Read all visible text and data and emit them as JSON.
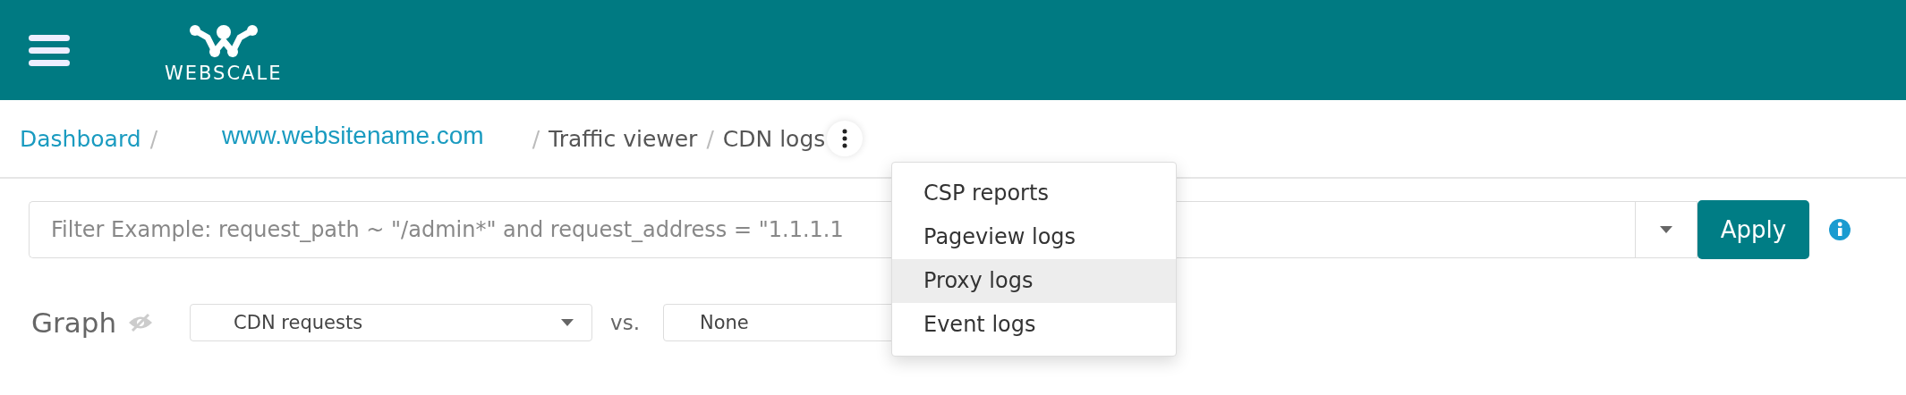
{
  "header": {
    "logo_text": "WEBSCALE"
  },
  "breadcrumb": [
    {
      "label": "Dashboard",
      "kind": "link"
    },
    {
      "label": "www.websitename.com",
      "kind": "site",
      "separator": "/"
    },
    {
      "label": "Traffic viewer",
      "kind": "text",
      "separator": "/"
    },
    {
      "label": "CDN logs",
      "kind": "text",
      "separator": "/"
    }
  ],
  "filter": {
    "placeholder": "Filter Example: request_path ~ \"/admin*\" and request_address = \"1.1.1.1",
    "apply_label": "Apply"
  },
  "graph": {
    "label": "Graph",
    "metric": "CDN requests",
    "vs_label": "vs.",
    "compare": "None"
  },
  "menu": [
    {
      "label": "CSP reports",
      "highlighted": false
    },
    {
      "label": "Pageview logs",
      "highlighted": false
    },
    {
      "label": "Proxy logs",
      "highlighted": true
    },
    {
      "label": "Event logs",
      "highlighted": false
    }
  ]
}
